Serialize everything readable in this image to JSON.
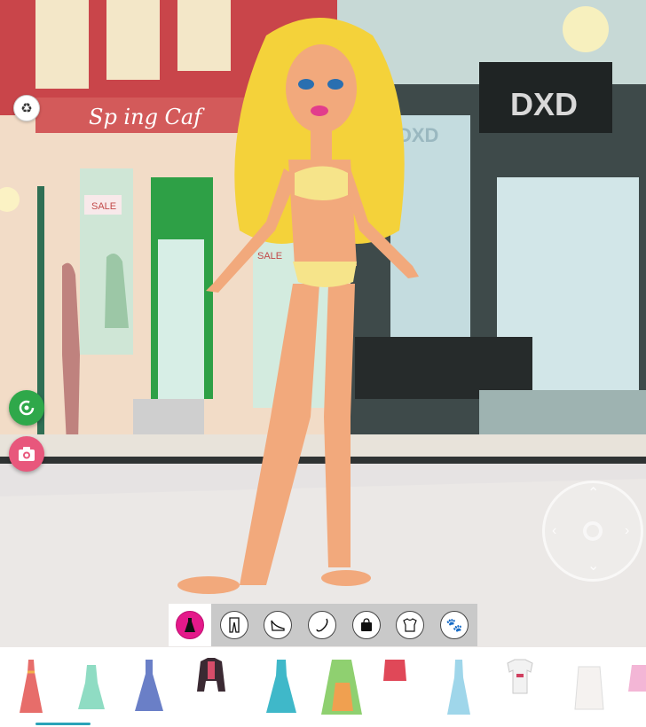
{
  "scene": {
    "cafe_sign": "Sp ing Caf",
    "store_sign": "DXD",
    "store_sign_small": "DXD",
    "window_sale_1": "SALE",
    "window_sale_2": "SALE"
  },
  "controls": {
    "recycle_icon": "recycle-icon",
    "rotate_icon": "rotate-icon",
    "camera_icon": "camera-icon",
    "dpad_icon": "dpad-icon"
  },
  "categories": [
    {
      "name": "dresses",
      "icon": "dress-icon",
      "active": true
    },
    {
      "name": "pants",
      "icon": "pants-icon",
      "active": false
    },
    {
      "name": "shoes",
      "icon": "shoe-icon",
      "active": false
    },
    {
      "name": "accessories",
      "icon": "necklace-icon",
      "active": false
    },
    {
      "name": "bags",
      "icon": "bag-icon",
      "active": false
    },
    {
      "name": "tops",
      "icon": "top-icon",
      "active": false
    },
    {
      "name": "pets",
      "icon": "paw-icon",
      "active": false
    }
  ],
  "items": [
    {
      "name": "coral-sequin-dress",
      "color": "#e76d6a"
    },
    {
      "name": "mint-ruffle-dress",
      "color": "#8fdcc3"
    },
    {
      "name": "blue-floral-dress",
      "color": "#6a7fc7"
    },
    {
      "name": "black-red-jacket",
      "color": "#3b2a33"
    },
    {
      "name": "teal-tiered-dress",
      "color": "#3fb8c9"
    },
    {
      "name": "green-orange-coat",
      "color": "#8fd070"
    },
    {
      "name": "red-ruffle-top",
      "color": "#e04858"
    },
    {
      "name": "light-blue-slip-dress",
      "color": "#9fd6ea"
    },
    {
      "name": "white-tshirt-top",
      "color": "#f2f2f2"
    },
    {
      "name": "white-lace-top",
      "color": "#f5f2f0"
    },
    {
      "name": "pink-top-partial",
      "color": "#f3b6d6"
    }
  ],
  "colors": {
    "accent_pink": "#e4198a",
    "rotate_green": "#2fa84a",
    "camera_pink": "#e8577c",
    "hair_yellow": "#f4d23a",
    "skin": "#f2a97c"
  }
}
